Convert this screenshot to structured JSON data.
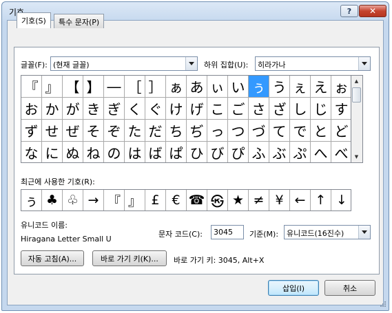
{
  "window": {
    "title": "기호"
  },
  "tabs": [
    {
      "label": "기호(S)"
    },
    {
      "label": "특수 문자(P)"
    }
  ],
  "font": {
    "label": "글꼴(F):",
    "value": "(현재 글꼴)"
  },
  "subset": {
    "label": "하위 집합(U):",
    "value": "히라가나"
  },
  "symbols": [
    [
      "『",
      "』",
      "【",
      "】",
      "―",
      "［",
      "］",
      "ぁ",
      "あ",
      "ぃ",
      "い",
      "ぅ",
      "う",
      "ぇ",
      "え",
      "ぉ"
    ],
    [
      "お",
      "か",
      "が",
      "き",
      "ぎ",
      "く",
      "ぐ",
      "け",
      "げ",
      "こ",
      "ご",
      "さ",
      "ざ",
      "し",
      "じ",
      "す"
    ],
    [
      "ず",
      "せ",
      "ぜ",
      "そ",
      "ぞ",
      "た",
      "だ",
      "ち",
      "ぢ",
      "っ",
      "つ",
      "づ",
      "て",
      "で",
      "と",
      "ど"
    ],
    [
      "な",
      "に",
      "ぬ",
      "ね",
      "の",
      "は",
      "ば",
      "ぱ",
      "ひ",
      "び",
      "ぴ",
      "ふ",
      "ぶ",
      "ぷ",
      "へ",
      "べ"
    ]
  ],
  "selected_symbol": "ぅ",
  "recent": {
    "label": "최근에 사용한 기호(R):",
    "items": [
      "ぅ",
      "♣",
      "♧",
      "→",
      "『",
      "』",
      "£",
      "€",
      "☎",
      "㉿",
      "★",
      "≠",
      "¥",
      "←",
      "↑",
      "↓"
    ]
  },
  "unicode_name": {
    "label": "유니코드 이름:",
    "value": "Hiragana Letter Small U"
  },
  "char_code": {
    "label": "문자 코드(C):",
    "value": "3045"
  },
  "from": {
    "label": "기준(M):",
    "value": "유니코드(16진수)"
  },
  "buttons": {
    "autocorrect": "자동 고침(A)...",
    "shortcut_key": "바로 가기 키(K)...",
    "insert": "삽입(I)",
    "cancel": "취소"
  },
  "shortcut_text": "바로 가기 키: 3045, Alt+X",
  "title_buttons": {
    "help": "?",
    "close": "✕"
  }
}
